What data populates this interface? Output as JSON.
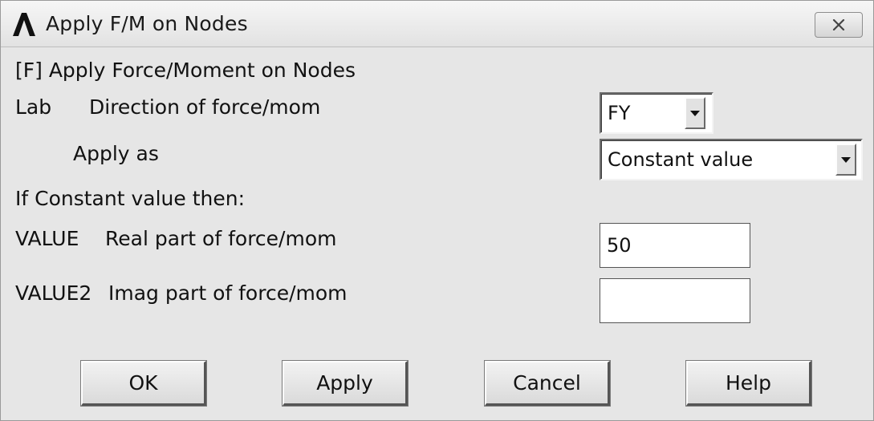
{
  "window": {
    "title": "Apply F/M on Nodes"
  },
  "dialog": {
    "heading": "[F]  Apply Force/Moment on Nodes",
    "lab_label": "Lab",
    "lab_description": "Direction of force/mom",
    "lab_selected": "FY",
    "apply_as_label": "Apply as",
    "apply_as_selected": "Constant value",
    "if_constant_label": "If Constant value then:",
    "value_label": "VALUE",
    "value_description": "Real part of force/mom",
    "value": "50",
    "value2_label": "VALUE2",
    "value2_description": "Imag part of force/mom",
    "value2": ""
  },
  "buttons": {
    "ok": "OK",
    "apply": "Apply",
    "cancel": "Cancel",
    "help": "Help"
  }
}
